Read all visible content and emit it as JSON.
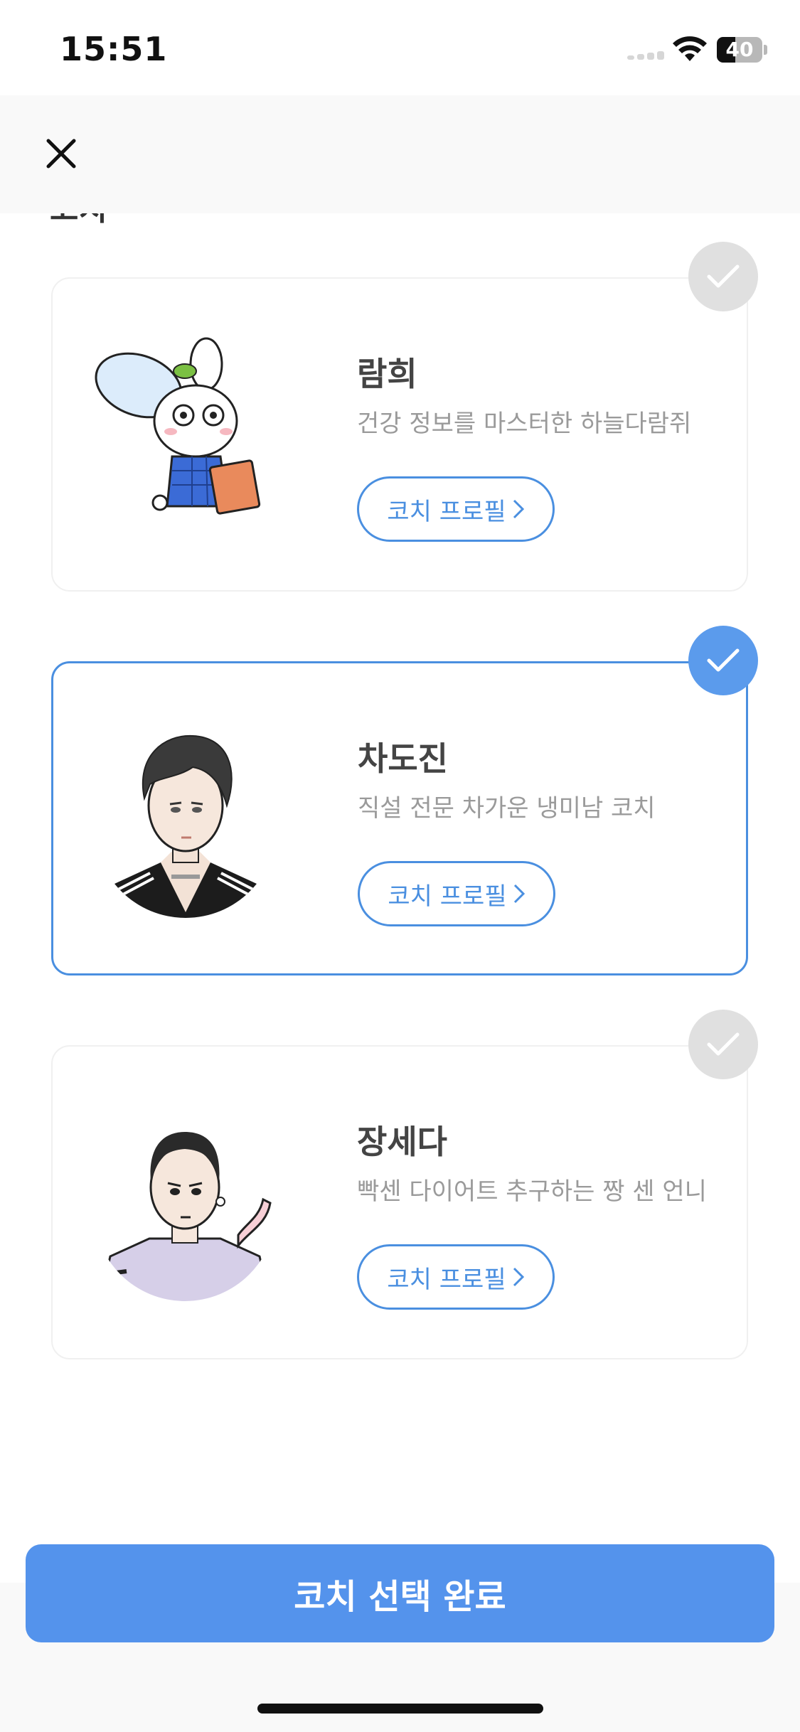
{
  "status_bar": {
    "time": "15:51",
    "battery": "40",
    "battery_level": 0.4
  },
  "header": {
    "close_icon": "close-icon"
  },
  "section": {
    "title": "코치"
  },
  "coaches": [
    {
      "name": "람희",
      "description": "건강 정보를 마스터한 하늘다람쥐",
      "profile_button": "코치 프로필",
      "selected": false,
      "avatar_icon": "flying-squirrel-avatar"
    },
    {
      "name": "차도진",
      "description": "직설 전문 차가운 냉미남 코치",
      "profile_button": "코치 프로필",
      "selected": true,
      "avatar_icon": "man-avatar"
    },
    {
      "name": "장세다",
      "description": "빡센 다이어트 추구하는 짱 센 언니",
      "profile_button": "코치 프로필",
      "selected": false,
      "avatar_icon": "woman-avatar"
    }
  ],
  "footer": {
    "complete_button": "코치 선택 완료"
  },
  "colors": {
    "accent": "#5493ec",
    "border_selected": "#4a8fe0",
    "check_off": "#e0e0e0",
    "check_on": "#5b9bec"
  }
}
